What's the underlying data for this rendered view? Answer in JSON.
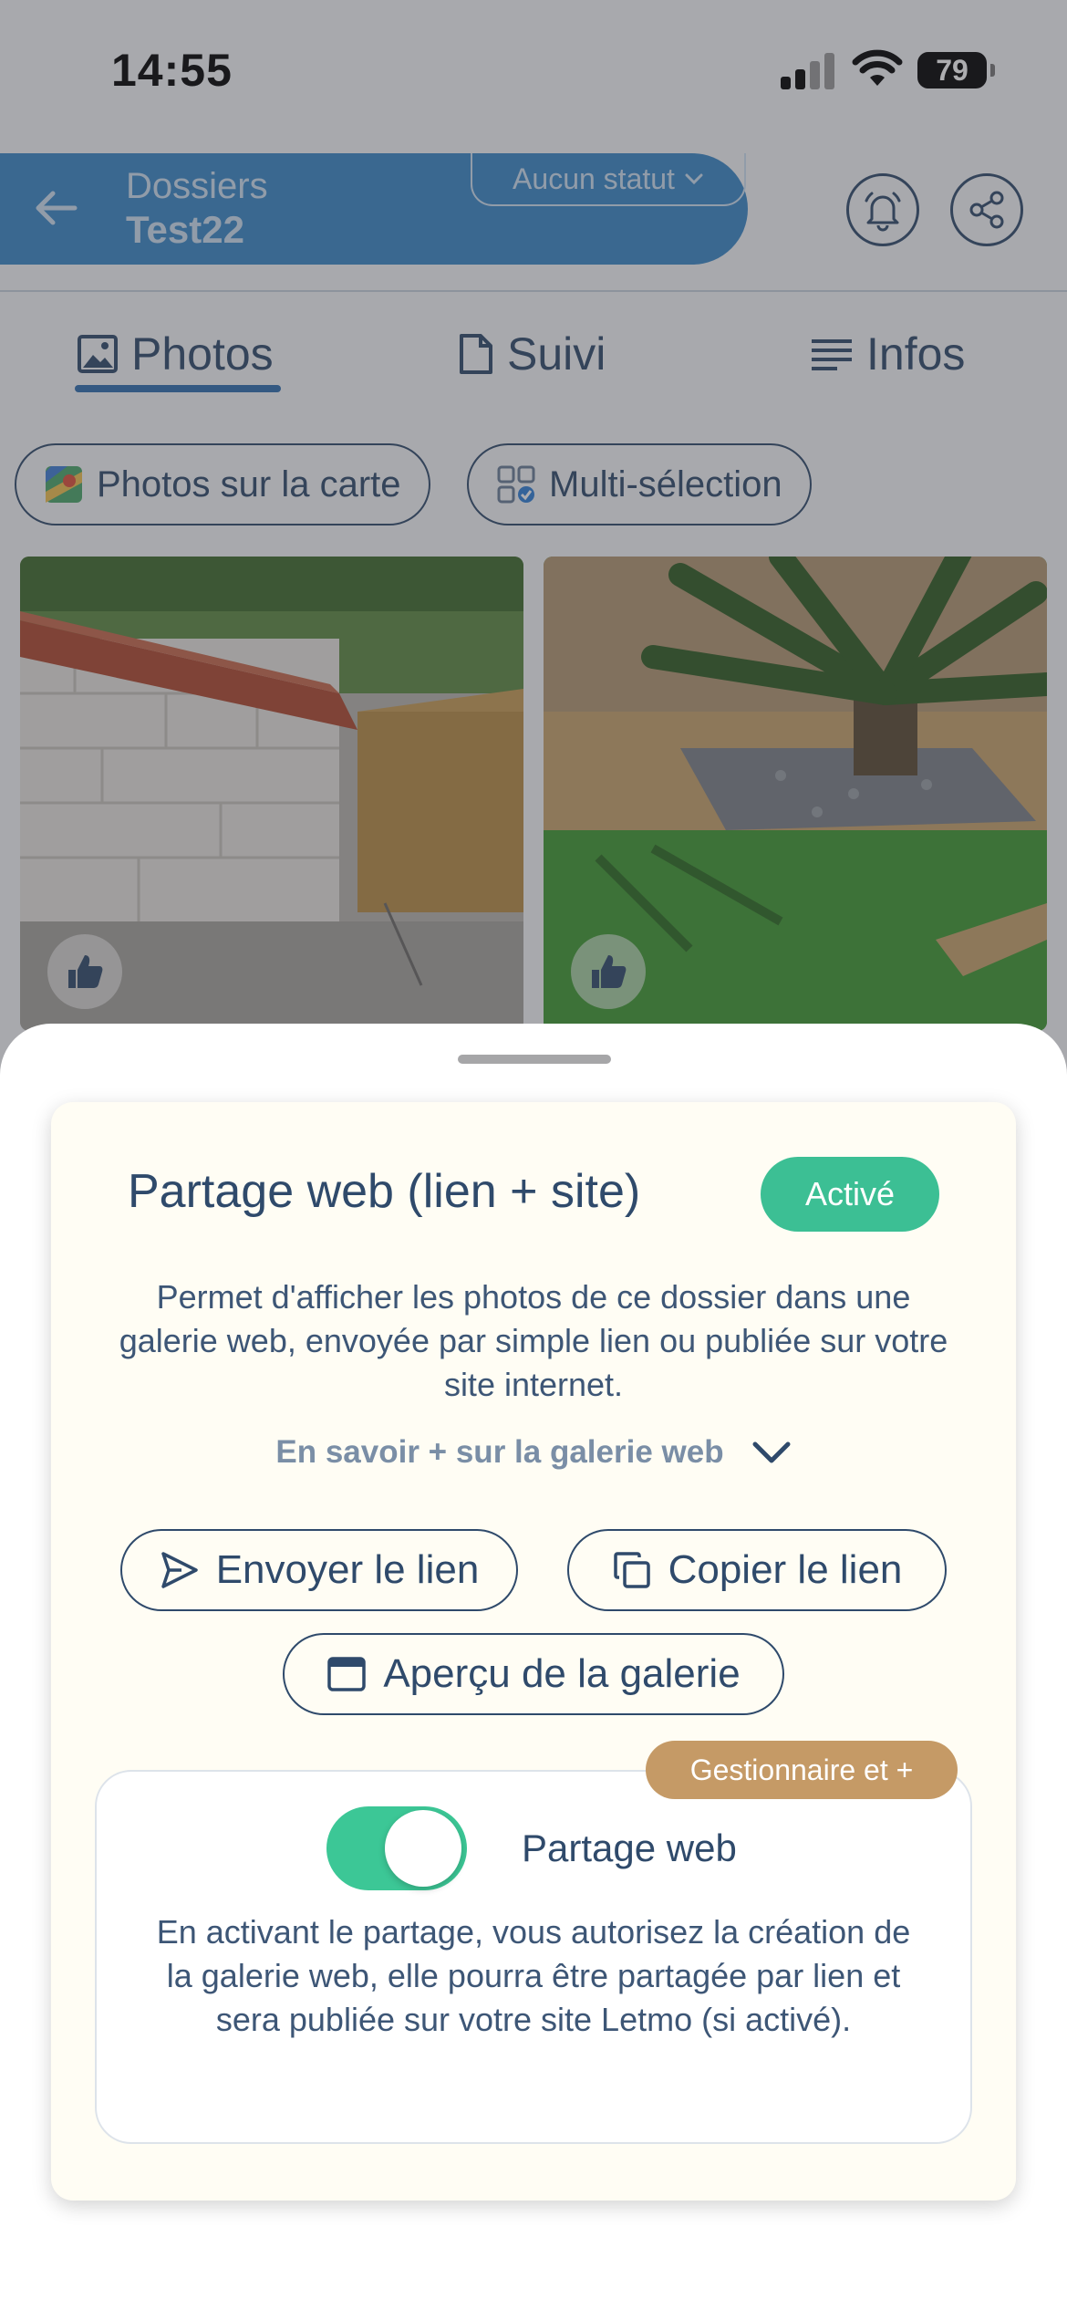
{
  "status_bar": {
    "time": "14:55",
    "battery": "79"
  },
  "header": {
    "breadcrumb": "Dossiers",
    "folder_name": "Test22",
    "status_select": "Aucun statut",
    "header_color": "#3a88c9"
  },
  "tabs": [
    {
      "label": "Photos",
      "icon": "image-icon",
      "selected": true
    },
    {
      "label": "Suivi",
      "icon": "document-icon",
      "selected": false
    },
    {
      "label": "Infos",
      "icon": "lines-icon",
      "selected": false
    }
  ],
  "chips": [
    {
      "label": "Photos sur la carte",
      "icon": "map-icon"
    },
    {
      "label": "Multi-sélection",
      "icon": "grid-select-icon"
    }
  ],
  "photos": [
    {
      "subject": "stone shed with tiled roof and wooden bin",
      "icon": "thumbs-up-icon"
    },
    {
      "subject": "palm tree in wooden planter with gravel",
      "icon": "thumbs-up-icon"
    }
  ],
  "sheet": {
    "title": "Partage web (lien + site)",
    "active_badge": "Activé",
    "active_color": "#3cbf94",
    "description": "Permet d'afficher les photos de ce dossier dans une galerie web, envoyée par simple lien ou publiée sur votre site internet.",
    "learn_more": "En savoir + sur la galerie web",
    "buttons": {
      "send_link": "Envoyer le lien",
      "copy_link": "Copier le lien",
      "preview": "Aperçu de la galerie"
    },
    "permission": {
      "role_badge": "Gestionnaire et +",
      "role_color": "#c59a66",
      "toggle_label": "Partage web",
      "toggle_on": true,
      "description": "En activant le partage, vous autorisez la création de la galerie web, elle pourra être partagée par lien et sera publiée sur votre site Letmo (si activé)."
    }
  }
}
